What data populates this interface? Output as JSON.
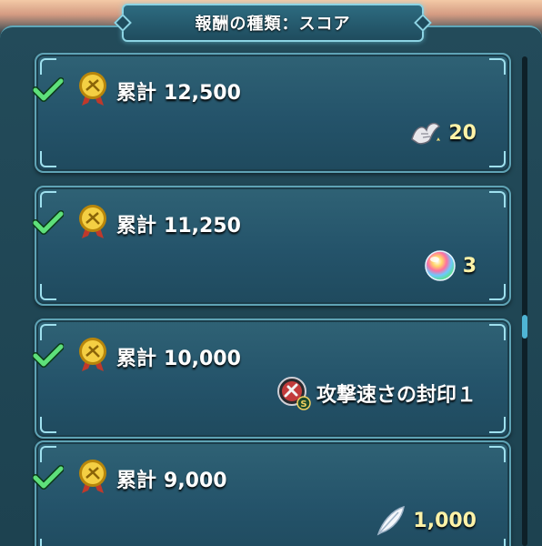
{
  "header": {
    "title": "報酬の種類：スコア"
  },
  "rewards": [
    {
      "label": "累計",
      "amount": "12,500",
      "reward_icon": "eagle-icon",
      "reward_text": "20"
    },
    {
      "label": "累計",
      "amount": "11,250",
      "reward_icon": "orb-icon",
      "reward_text": "3"
    },
    {
      "label": "累計",
      "amount": "10,000",
      "reward_icon": "seal-icon",
      "reward_text": "攻撃速さの封印１"
    },
    {
      "label": "累計",
      "amount": "9,000",
      "reward_icon": "feather-icon",
      "reward_text": "1,000"
    }
  ],
  "colors": {
    "accent": "#8cd3e3",
    "check": "#5ee07a",
    "quantity": "#fff3a8",
    "card": "#2f6275"
  },
  "scroll": {
    "position": 0.55
  }
}
